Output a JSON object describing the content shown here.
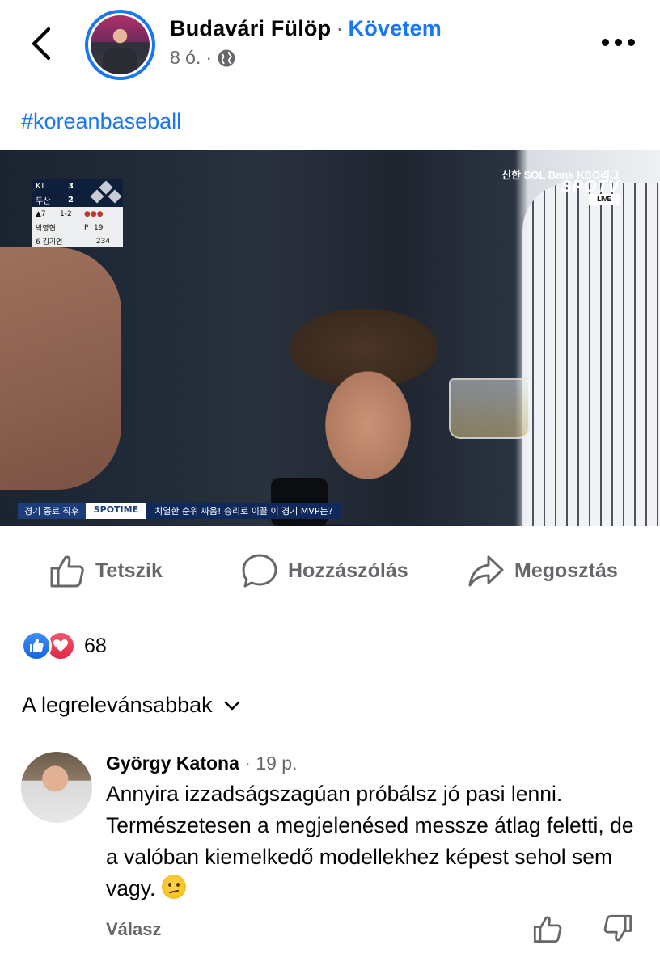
{
  "post": {
    "author": "Budavári Fülöp",
    "separator": "·",
    "follow_label": "Követem",
    "time": "8 ó.",
    "time_separator": "·",
    "visibility_icon": "globe-icon",
    "hashtag": "#koreanbaseball"
  },
  "broadcast": {
    "scoreboard": {
      "team1": "KT",
      "score1": "3",
      "team2": "두산",
      "score2": "2",
      "inning": "▲7",
      "count": "1-2",
      "pitcher": "박영현",
      "pitch_label": "P",
      "pitch_count": "19",
      "batter": "6 김기연",
      "batter_avg": ".234"
    },
    "sponsor": "신한 SOL Bank KBO리그",
    "network": "SPOTV",
    "live_label": "LIVE",
    "ticker_label": "경기 종료 직후",
    "ticker_brand": "SPOTIME",
    "ticker_text": "치열한 순위 싸움! 승리로 이끌 이 경기 MVP는?"
  },
  "actions": {
    "like_label": "Tetszik",
    "comment_label": "Hozzászólás",
    "share_label": "Megosztás"
  },
  "reactions": {
    "count": "68",
    "types": [
      "like-icon",
      "love-icon"
    ],
    "like_color": "#1877f2",
    "love_color": "#f33e58"
  },
  "sort": {
    "label": "A legrelevánsabbak"
  },
  "comment": {
    "author": "György Katona",
    "separator": "·",
    "time": "19 p.",
    "text": "Annyira izzadságszagúan próbálsz jó pasi lenni. Természetesen a megjelenésed messze átlag feletti, de a valóban kiemelkedő modellekhez képest sehol sem vagy.",
    "reply_label": "Válasz"
  },
  "theme": {
    "accent": "#1877f2",
    "secondary_text": "#65676b"
  }
}
